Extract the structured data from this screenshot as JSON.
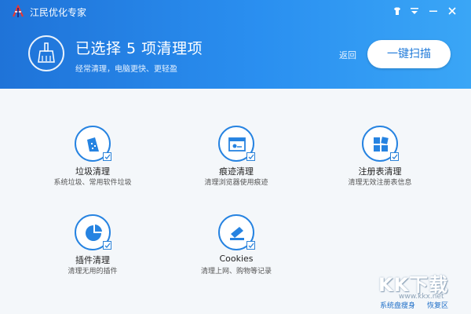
{
  "app": {
    "title": "江民优化专家"
  },
  "window_controls": {
    "skin": "skin-icon",
    "menu": "menu-icon",
    "minimize": "minimize-icon",
    "close": "close-icon"
  },
  "hero": {
    "title": "已选择 5 项清理项",
    "subtitle": "经常清理，电脑更快、更轻盈",
    "back_label": "返回",
    "scan_label": "一键扫描"
  },
  "items": [
    {
      "label": "垃圾清理",
      "desc": "系统垃圾、常用软件垃圾",
      "icon": "trash-icon",
      "checked": true
    },
    {
      "label": "痕迹清理",
      "desc": "清理浏览器使用痕迹",
      "icon": "browser-icon",
      "checked": true
    },
    {
      "label": "注册表清理",
      "desc": "清理无效注册表信息",
      "icon": "registry-icon",
      "checked": true
    },
    {
      "label": "插件清理",
      "desc": "清理无用的插件",
      "icon": "plugin-icon",
      "checked": true
    },
    {
      "label": "Cookies",
      "desc": "清理上网、购物等记录",
      "icon": "cookies-icon",
      "checked": true
    }
  ],
  "footer": {
    "slim_label": "系统盘瘦身",
    "restore_label": "恢复区"
  },
  "watermark": {
    "text": "KK下载",
    "url": "www.kkx.net"
  },
  "colors": {
    "accent": "#1f7ad9",
    "header": "#2a8ff0"
  }
}
